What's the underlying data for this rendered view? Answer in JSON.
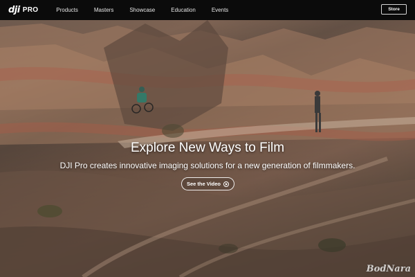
{
  "brand": {
    "logo": "dji",
    "product": "PRO"
  },
  "nav": {
    "links": [
      "Products",
      "Masters",
      "Showcase",
      "Education",
      "Events"
    ],
    "store_label": "Store"
  },
  "hero": {
    "title": "Explore New Ways to Film",
    "subtitle": "DJI Pro creates innovative imaging solutions for a new generation of filmmakers.",
    "cta_label": "See the Video",
    "cta_icon": "play-circle-icon"
  },
  "watermark": {
    "text": "BodNara"
  },
  "colors": {
    "navbar_bg": "#0b0b0b",
    "text": "#ffffff",
    "terrain": "#8d6f5d"
  }
}
